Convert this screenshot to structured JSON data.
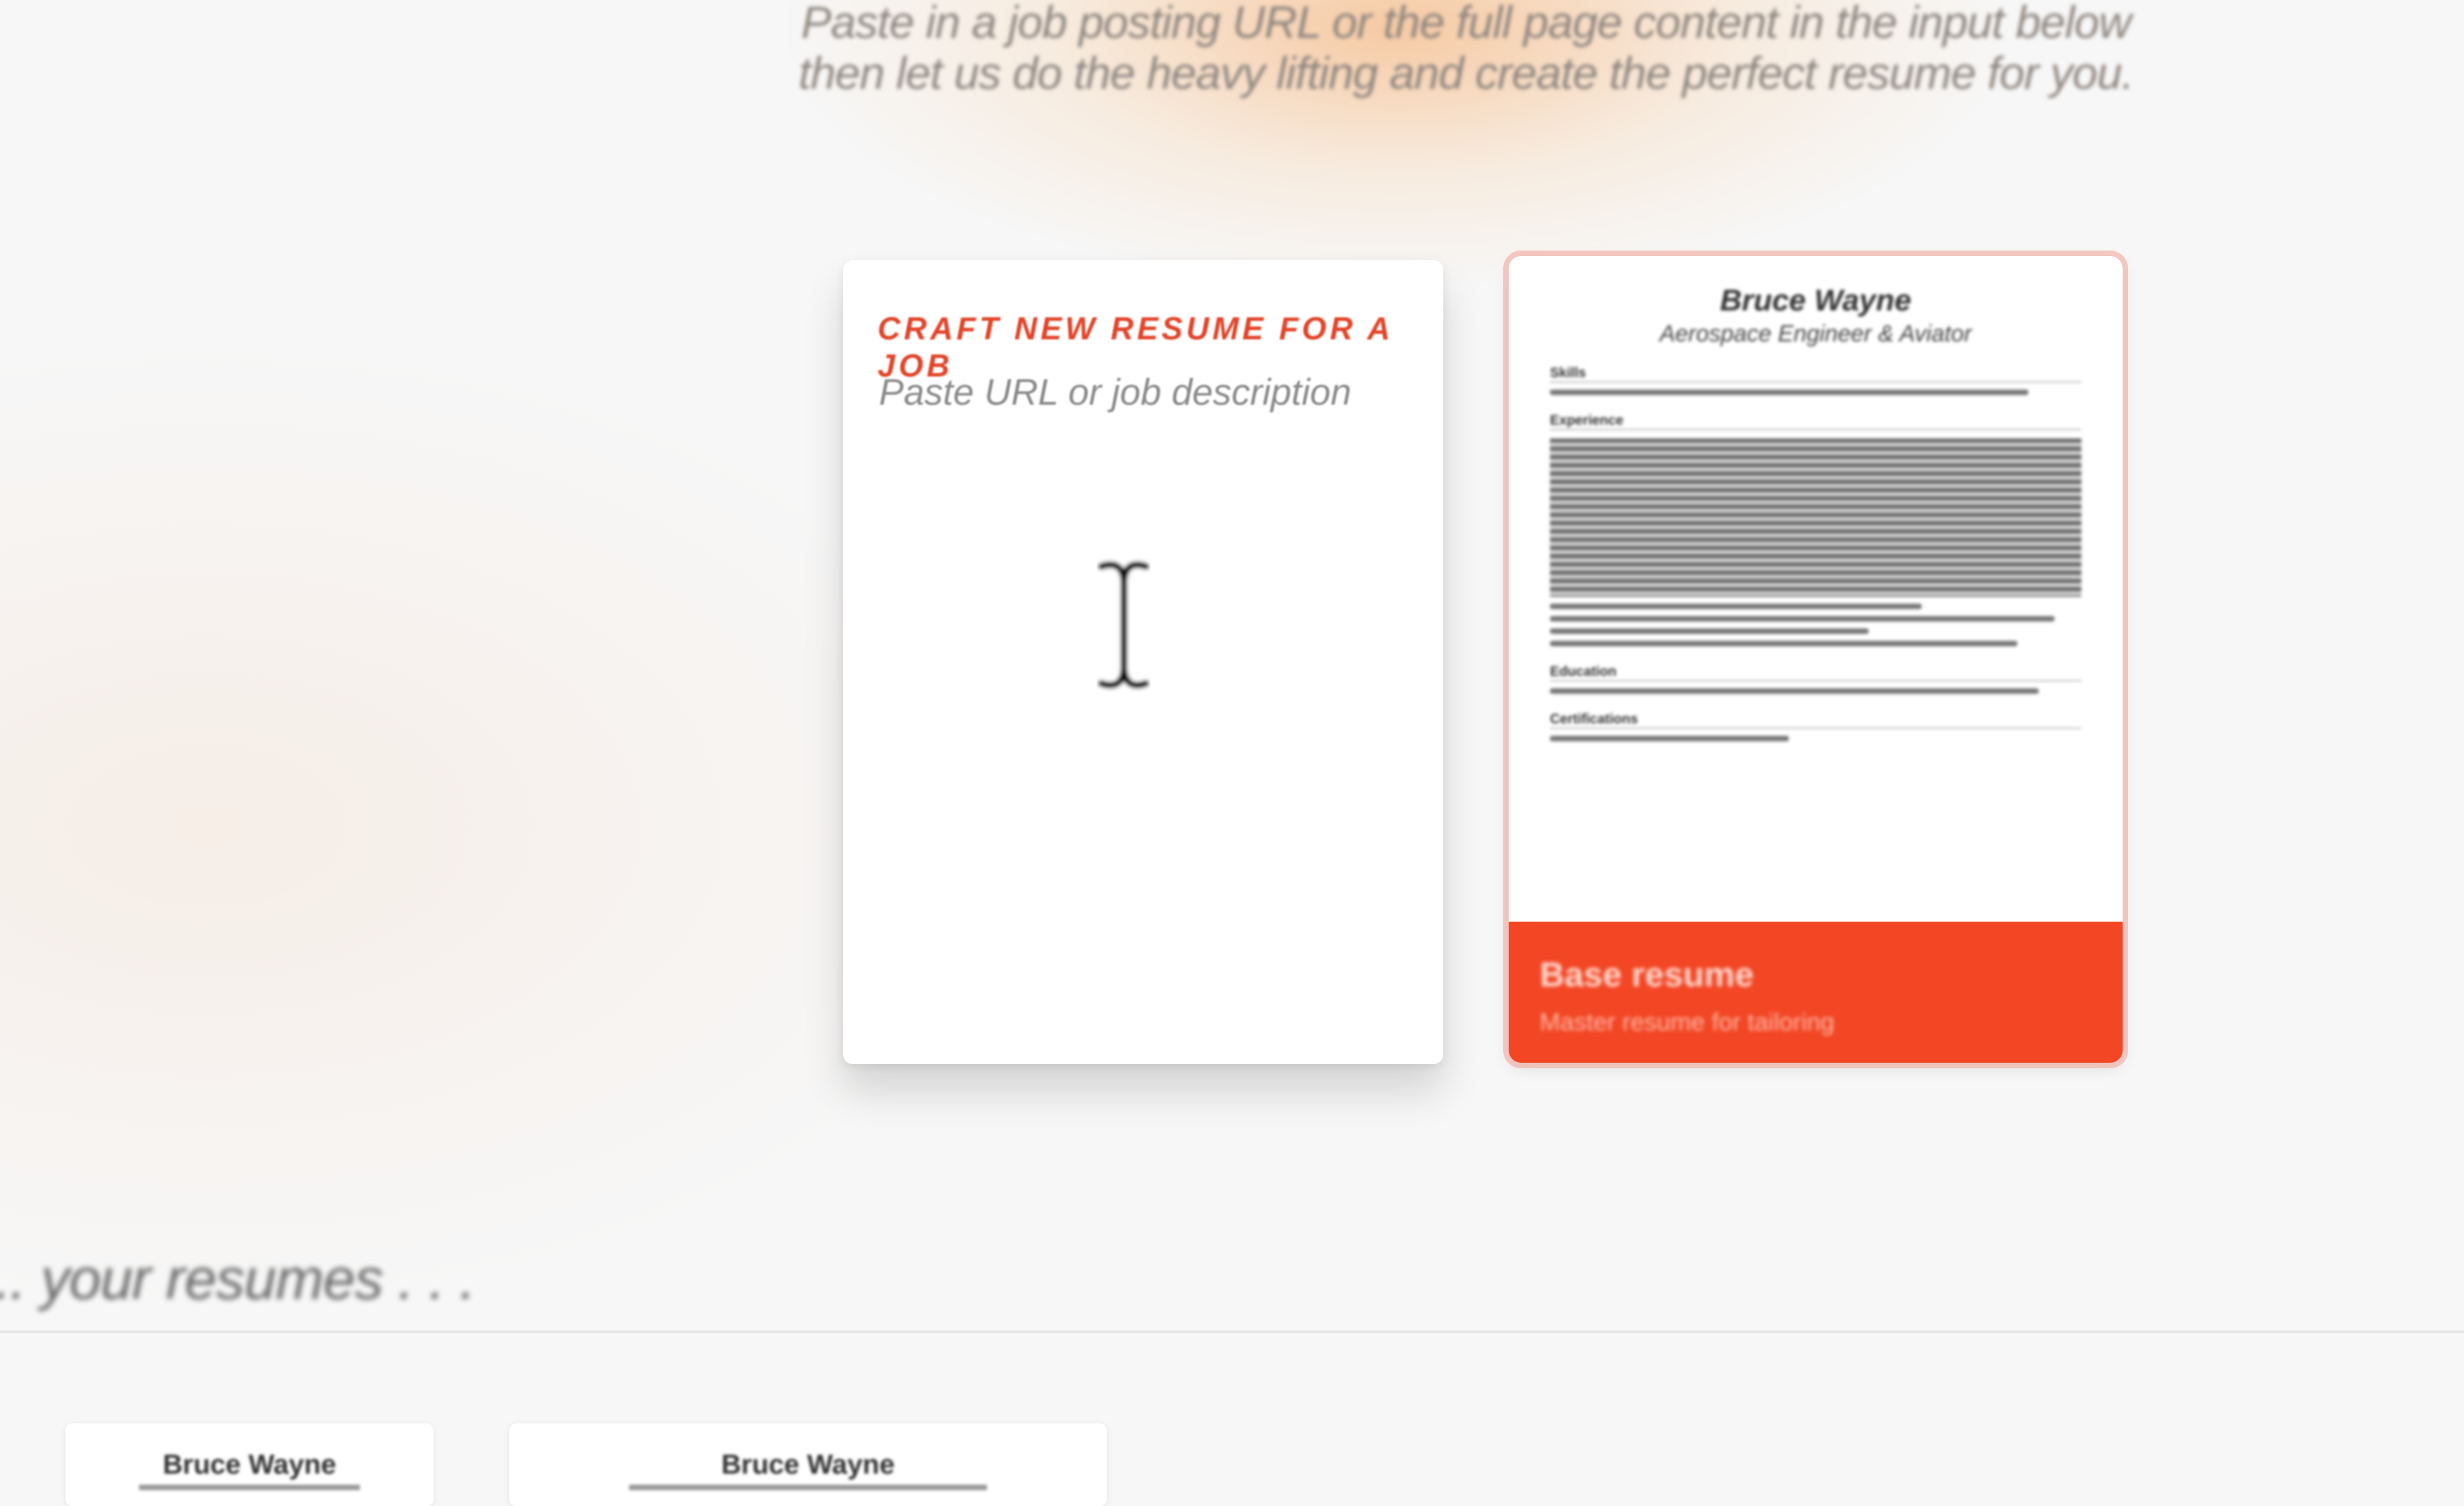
{
  "header": {
    "tagline": "Paste in a job posting URL or the full page content in the input below then let us do the heavy lifting and create the perfect resume for you."
  },
  "craft_card": {
    "title": "CRAFT NEW RESUME FOR A JOB",
    "input_placeholder": "Paste URL or job description",
    "cursor_icon": "text-cursor-icon"
  },
  "base_card": {
    "preview": {
      "name": "Bruce Wayne",
      "subtitle": "Aerospace Engineer & Aviator",
      "sections": [
        "Skills",
        "Experience",
        "Education",
        "Certifications"
      ]
    },
    "title": "Base resume",
    "subtitle": "Master resume for tailoring"
  },
  "resumes_section": {
    "heading": "... your resumes . . .",
    "cards": [
      {
        "name": "Bruce Wayne"
      },
      {
        "name": "Bruce Wayne"
      }
    ]
  },
  "colors": {
    "accent": "#f24624",
    "title_red": "#e2452a",
    "background": "#f7f7f7"
  }
}
